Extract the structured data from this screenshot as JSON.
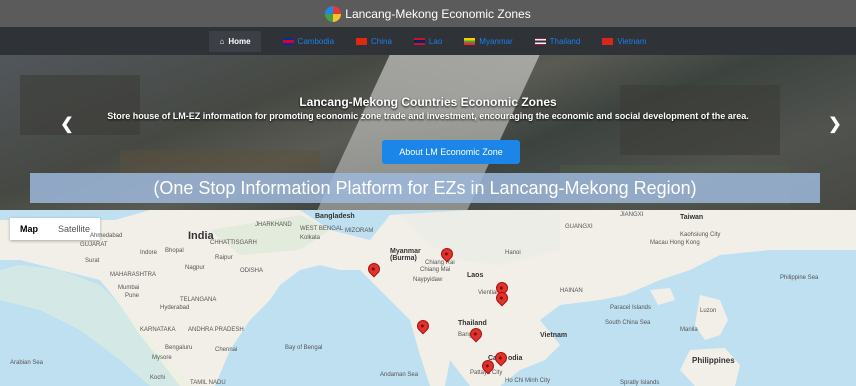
{
  "header": {
    "title": "Lancang-Mekong Economic Zones"
  },
  "nav": {
    "home": "Home",
    "items": [
      {
        "label": "Cambodia",
        "flag": "#2b3990"
      },
      {
        "label": "China",
        "flag": "#de2910"
      },
      {
        "label": "Lao",
        "flag": "#ce1126"
      },
      {
        "label": "Myanmar",
        "flag": "#fecb00"
      },
      {
        "label": "Thailand",
        "flag": "#241d4f"
      },
      {
        "label": "Vietnam",
        "flag": "#da251d"
      }
    ]
  },
  "hero": {
    "title": "Lancang-Mekong Countries Economic Zones",
    "subtitle": "Store house of LM-EZ information for promoting economic zone trade and investment, encouraging the economic and social development of the area.",
    "button": "About LM Economic Zone",
    "banner": "(One Stop Information Platform for EZs in Lancang-Mekong Region)"
  },
  "map": {
    "types": {
      "map": "Map",
      "satellite": "Satellite"
    },
    "labels": {
      "india": "India",
      "bangladesh": "Bangladesh",
      "myanmar": "Myanmar\n(Burma)",
      "laos": "Laos",
      "thailand": "Thailand",
      "vietnam": "Vietnam",
      "cambodia_part1": "Ca",
      "cambodia_part2": "odia",
      "philippines": "Philippines",
      "taiwan": "Taiwan",
      "hanoi": "Hanoi",
      "bangkok": "Bangkok",
      "kolkata": "Kolkata",
      "mumbai": "Mumbai",
      "hyderabad": "Hyderabad",
      "ahmedabad": "Ahmedabad",
      "bengaluru": "Bengaluru",
      "chennai": "Chennai",
      "chiang_mai": "Chiang Mai",
      "manila": "Manila",
      "hong_kong": "Macau Hong Kong",
      "bay_of_bengal": "Bay of Bengal",
      "andaman_sea": "Andaman Sea",
      "arabian_sea": "Arabian Sea",
      "south_china_sea": "South China Sea",
      "philippine_sea": "Philippine Sea",
      "guangxi": "GUANGXI",
      "jiangxi": "JIANGXI",
      "hainan": "HAINAN",
      "gujarat": "GUJARAT",
      "maharashtra": "MAHARASHTRA",
      "telangana": "TELANGANA",
      "karnataka": "KARNATAKA",
      "andhra": "ANDHRA PRADESH",
      "tamil": "TAMIL NADU",
      "odisha": "ODISHA",
      "chhattisgarh": "CHHATTISGARH",
      "jharkhand": "JHARKHAND",
      "west_bengal": "WEST BENGAL",
      "mizoram": "MIZORAM",
      "vientiane": "Vientiane",
      "pattaya": "Pattaya City",
      "ho_chi_minh": "Ho Chi Minh City",
      "kaohsiung": "Kaohsiung City",
      "naypyidaw": "Naypyidaw",
      "surat": "Surat",
      "mysore": "Mysore",
      "kochi": "Kochi",
      "paracel": "Paracel Islands",
      "luzon": "Luzon",
      "spratly": "Spratly Islands",
      "chiang_rai": "Chiang Rai",
      "indore": "Indore",
      "nagpur": "Nagpur",
      "pune": "Pune",
      "bhopal": "Bhopal",
      "raipur": "Raipur"
    }
  }
}
